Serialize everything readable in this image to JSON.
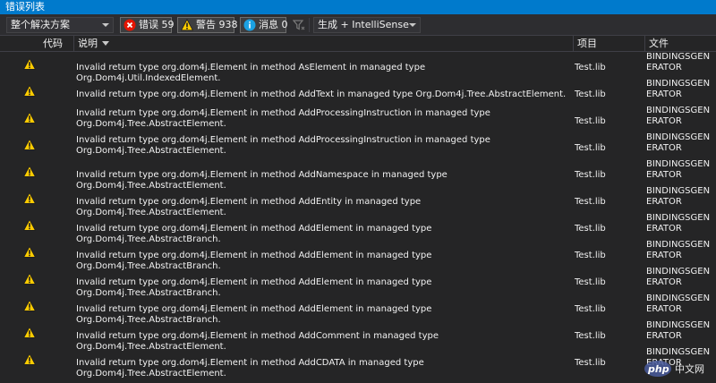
{
  "window": {
    "title": "错误列表"
  },
  "toolbar": {
    "scope": "整个解决方案",
    "errors": "错误 59",
    "warnings": "警告 938",
    "messages": "消息 0",
    "build_filter": "生成 + IntelliSense"
  },
  "columns": {
    "code": "代码",
    "description": "说明",
    "project": "项目",
    "file": "文件"
  },
  "rows": [
    {
      "description": "Invalid return type org.dom4j.Element in method AsElement in managed type Org.Dom4j.Util.IndexedElement.",
      "project": "Test.lib",
      "file": "BINDINGSGENERATOR"
    },
    {
      "description": "Invalid return type org.dom4j.Element in method AddText in managed type Org.Dom4j.Tree.AbstractElement.",
      "project": "Test.lib",
      "file": "BINDINGSGENERATOR"
    },
    {
      "description": "Invalid return type org.dom4j.Element in method AddProcessingInstruction in managed type Org.Dom4j.Tree.AbstractElement.",
      "project": "Test.lib",
      "file": "BINDINGSGENERATOR"
    },
    {
      "description": "Invalid return type org.dom4j.Element in method AddProcessingInstruction in managed type Org.Dom4j.Tree.AbstractElement.",
      "project": "Test.lib",
      "file": "BINDINGSGENERATOR"
    },
    {
      "description": "Invalid return type org.dom4j.Element in method AddNamespace in managed type Org.Dom4j.Tree.AbstractElement.",
      "project": "Test.lib",
      "file": "BINDINGSGENERATOR"
    },
    {
      "description": "Invalid return type org.dom4j.Element in method AddEntity in managed type Org.Dom4j.Tree.AbstractElement.",
      "project": "Test.lib",
      "file": "BINDINGSGENERATOR"
    },
    {
      "description": "Invalid return type org.dom4j.Element in method AddElement in managed type Org.Dom4j.Tree.AbstractBranch.",
      "project": "Test.lib",
      "file": "BINDINGSGENERATOR"
    },
    {
      "description": "Invalid return type org.dom4j.Element in method AddElement in managed type Org.Dom4j.Tree.AbstractBranch.",
      "project": "Test.lib",
      "file": "BINDINGSGENERATOR"
    },
    {
      "description": "Invalid return type org.dom4j.Element in method AddElement in managed type Org.Dom4j.Tree.AbstractBranch.",
      "project": "Test.lib",
      "file": "BINDINGSGENERATOR"
    },
    {
      "description": "Invalid return type org.dom4j.Element in method AddElement in managed type Org.Dom4j.Tree.AbstractBranch.",
      "project": "Test.lib",
      "file": "BINDINGSGENERATOR"
    },
    {
      "description": "Invalid return type org.dom4j.Element in method AddComment in managed type Org.Dom4j.Tree.AbstractElement.",
      "project": "Test.lib",
      "file": "BINDINGSGENERATOR"
    },
    {
      "description": "Invalid return type org.dom4j.Element in method AddCDATA in managed type Org.Dom4j.Tree.AbstractElement.",
      "project": "Test.lib",
      "file": "BINDINGSGENERATOR"
    }
  ],
  "icons": {
    "row_severity": "warning-icon",
    "errors": "error-icon",
    "warnings": "warning-icon",
    "messages": "info-icon",
    "filter": "filter-icon"
  },
  "colors": {
    "accent": "#007acc",
    "error": "#e51400",
    "warning": "#ffcc00",
    "info": "#1ba1e2"
  },
  "watermark": "php 中文网"
}
